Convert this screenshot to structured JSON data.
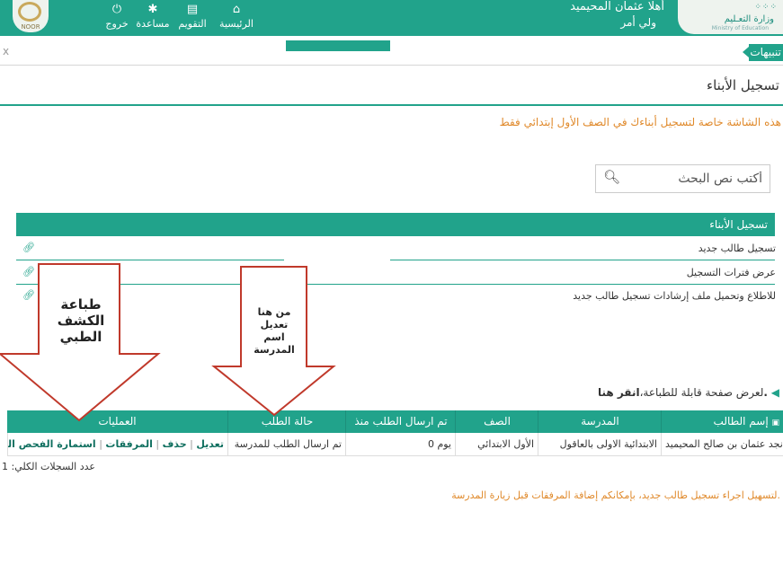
{
  "header": {
    "user_name": "أهلا عثمان المحيميد",
    "user_role": "ولي أمر",
    "ministry_name": "وزارة التعـليم",
    "ministry_en": "Ministry of Education",
    "noor_text": "NOOR",
    "nav": [
      {
        "label": "الرئيسية",
        "icon": "home-icon"
      },
      {
        "label": "التقويم",
        "icon": "calendar-icon"
      },
      {
        "label": "مساعدة",
        "icon": "gear-icon"
      },
      {
        "label": "خروج",
        "icon": "power-icon"
      }
    ]
  },
  "tabs": {
    "active_label": "تنبيهات",
    "close": "x"
  },
  "page": {
    "title": "تسجيل الأبناء",
    "notice": "هذه الشاشة خاصة لتسجيل أبناءك في الصف الأول إبتدائي فقط",
    "search_placeholder": "أكتب نص البحث",
    "panel": {
      "heading": "تسجيل الأبناء",
      "items": [
        "تسجيل طالب جديد",
        "عرض فترات التسجيل",
        "للاطلاع وتحميل ملف إرشادات تسجيل طالب جديد"
      ]
    },
    "print_link": {
      "prefix": "لعرض صفحة قابلة للطباعة،",
      "link": "انقر هنا."
    },
    "table": {
      "headers": [
        "إسم الطالب",
        "المدرسة",
        "الصف",
        "تم ارسال الطلب منذ",
        "حالة الطلب",
        "العمليات"
      ],
      "rows": [
        {
          "student": "نجد عثمان بن صالح المحيميد",
          "school": "الابتدائية الاولى بالعاقول",
          "grade": "الأول الابتدائي",
          "since": "0 يوم",
          "status": "تم ارسال الطلب للمدرسة",
          "ops": [
            "تعديل",
            "حذف",
            "المرفقات",
            "استمارة الفحص الطبي الميداني"
          ]
        }
      ]
    },
    "total": "عدد السجلات الكلي: 1",
    "footnote": "لتسهيل اجراء تسجيل طالب جديد، بإمكانكم إضافة المرفقات قبل زيارة المدرسة."
  },
  "annotations": {
    "left_callout": [
      "طباعة",
      "الكشف الطبي"
    ],
    "right_callout": [
      "من هنا",
      "تعديل",
      "اسم",
      "المدرسة"
    ]
  },
  "colors": {
    "accent": "#21a38b",
    "notice": "#e08a2c",
    "callout_border": "#c0392b"
  }
}
